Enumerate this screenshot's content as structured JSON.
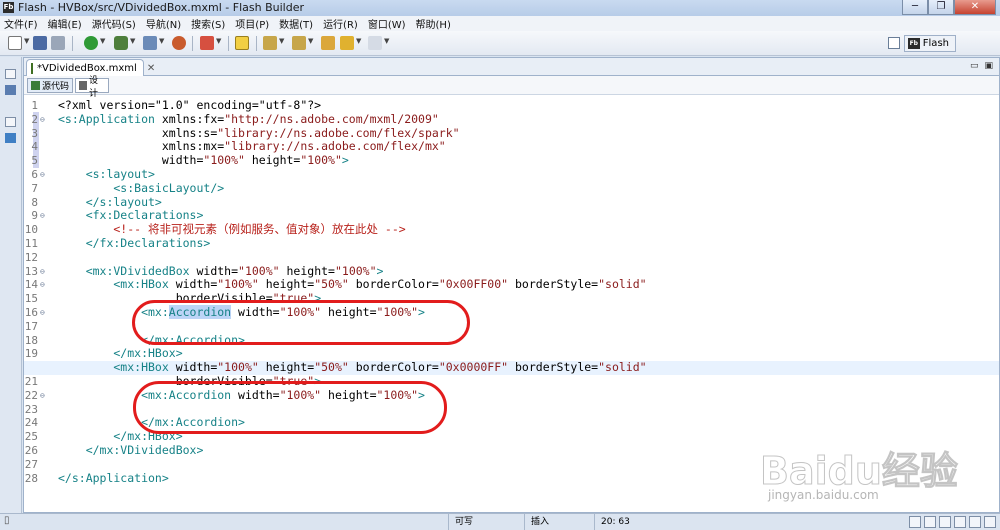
{
  "window": {
    "icon_label": "Fb",
    "title": "Flash - HVBox/src/VDividedBox.mxml - Flash Builder",
    "buttons": [
      "─",
      "❐",
      "✕"
    ]
  },
  "menu": [
    "文件(F)",
    "编辑(E)",
    "源代码(S)",
    "导航(N)",
    "搜索(S)",
    "项目(P)",
    "数据(T)",
    "运行(R)",
    "窗口(W)",
    "帮助(H)"
  ],
  "perspective": {
    "icon_label": "Fb",
    "label": "Flash"
  },
  "editor": {
    "tab_label": "*VDividedBox.mxml",
    "tab_close": "✕",
    "mode_source": "源代码",
    "mode_design": "设计",
    "minmax": [
      "▭",
      "▣"
    ]
  },
  "code_lines": [
    {
      "n": "1",
      "fold": "",
      "marker": false
    },
    {
      "n": "2",
      "fold": "⊖",
      "marker": true
    },
    {
      "n": "3",
      "fold": "",
      "marker": true
    },
    {
      "n": "4",
      "fold": "",
      "marker": true
    },
    {
      "n": "5",
      "fold": "",
      "marker": true
    },
    {
      "n": "6",
      "fold": "⊖",
      "marker": false
    },
    {
      "n": "7",
      "fold": "",
      "marker": false
    },
    {
      "n": "8",
      "fold": "",
      "marker": false
    },
    {
      "n": "9",
      "fold": "⊖",
      "marker": false
    },
    {
      "n": "10",
      "fold": "",
      "marker": false
    },
    {
      "n": "11",
      "fold": "",
      "marker": false
    },
    {
      "n": "12",
      "fold": "",
      "marker": false
    },
    {
      "n": "13",
      "fold": "⊖",
      "marker": false
    },
    {
      "n": "14",
      "fold": "⊖",
      "marker": false
    },
    {
      "n": "15",
      "fold": "",
      "marker": false
    },
    {
      "n": "16",
      "fold": "⊖",
      "marker": false
    },
    {
      "n": "17",
      "fold": "",
      "marker": false
    },
    {
      "n": "18",
      "fold": "",
      "marker": false
    },
    {
      "n": "19",
      "fold": "",
      "marker": false
    },
    {
      "n": "20",
      "fold": "⊖",
      "marker": false
    },
    {
      "n": "21",
      "fold": "",
      "marker": false
    },
    {
      "n": "22",
      "fold": "⊖",
      "marker": false
    },
    {
      "n": "23",
      "fold": "",
      "marker": false
    },
    {
      "n": "24",
      "fold": "",
      "marker": false
    },
    {
      "n": "25",
      "fold": "",
      "marker": false
    },
    {
      "n": "26",
      "fold": "",
      "marker": false
    },
    {
      "n": "27",
      "fold": "",
      "marker": false
    },
    {
      "n": "28",
      "fold": "",
      "marker": false
    }
  ],
  "code": {
    "l1": "<?xml version=\"1.0\" encoding=\"utf-8\"?>",
    "l2a": "<s:Application",
    "l2b": " xmlns:fx=",
    "l2c": "\"http://ns.adobe.com/mxml/2009\"",
    "l3a": "               xmlns:s=",
    "l3b": "\"library://ns.adobe.com/flex/spark\"",
    "l4a": "               xmlns:mx=",
    "l4b": "\"library://ns.adobe.com/flex/mx\"",
    "l5a": "               width=",
    "l5b": "\"100%\"",
    "l5c": " height=",
    "l5d": "\"100%\"",
    "l5e": ">",
    "l6": "    <s:layout>",
    "l7": "        <s:BasicLayout/>",
    "l8": "    </s:layout>",
    "l9": "    <fx:Declarations>",
    "l10": "        <!-- 将非可视元素（例如服务、值对象）放在此处 -->",
    "l11": "    </fx:Declarations>",
    "l12": "",
    "l13a": "    <mx:VDividedBox",
    "l13b": " width=",
    "l13c": "\"100%\"",
    "l13d": " height=",
    "l13e": "\"100%\"",
    "l13f": ">",
    "l14a": "        <mx:HBox",
    "l14b": " width=",
    "l14c": "\"100%\"",
    "l14d": " height=",
    "l14e": "\"50%\"",
    "l14f": " borderColor=",
    "l14g": "\"0x00FF00\"",
    "l14h": " borderStyle=",
    "l14i": "\"solid\"",
    "l15a": "                 borderVisible=",
    "l15b": "\"true\"",
    "l15c": ">",
    "l16a": "            <mx:",
    "l16sel": "Accordion",
    "l16b": " width=",
    "l16c": "\"100%\"",
    "l16d": " height=",
    "l16e": "\"100%\"",
    "l16f": ">",
    "l17": "",
    "l18": "            </mx:Accordion>",
    "l19": "        </mx:HBox>",
    "l20a": "        <mx:HBox",
    "l20b": " width=",
    "l20c": "\"100%\"",
    "l20d": " height=",
    "l20e": "\"50%\"",
    "l20f": " borderColor=",
    "l20g": "\"0x0000FF\"",
    "l20h": " borderStyle=",
    "l20i": "\"solid\"",
    "l21a": "                 borderVisible=",
    "l21b": "\"true\"",
    "l21c": ">",
    "l22a": "            <mx:Accordion",
    "l22b": " width=",
    "l22c": "\"100%\"",
    "l22d": " height=",
    "l22e": "\"100%\"",
    "l22f": ">",
    "l23": "",
    "l24": "            </mx:Accordion>",
    "l25": "        </mx:HBox>",
    "l26": "    </mx:VDividedBox>",
    "l27": "",
    "l28": "</s:Application>"
  },
  "status": {
    "writable": "可写",
    "insert_mode": "插入",
    "position": "20: 63"
  },
  "watermark": {
    "brand": "Baidu经验",
    "url": "jingyan.baidu.com"
  },
  "colors": {
    "tag": "#168287",
    "value": "#8a1b1b",
    "comment": "#b8211b",
    "annotation_red": "#e21c1c"
  }
}
